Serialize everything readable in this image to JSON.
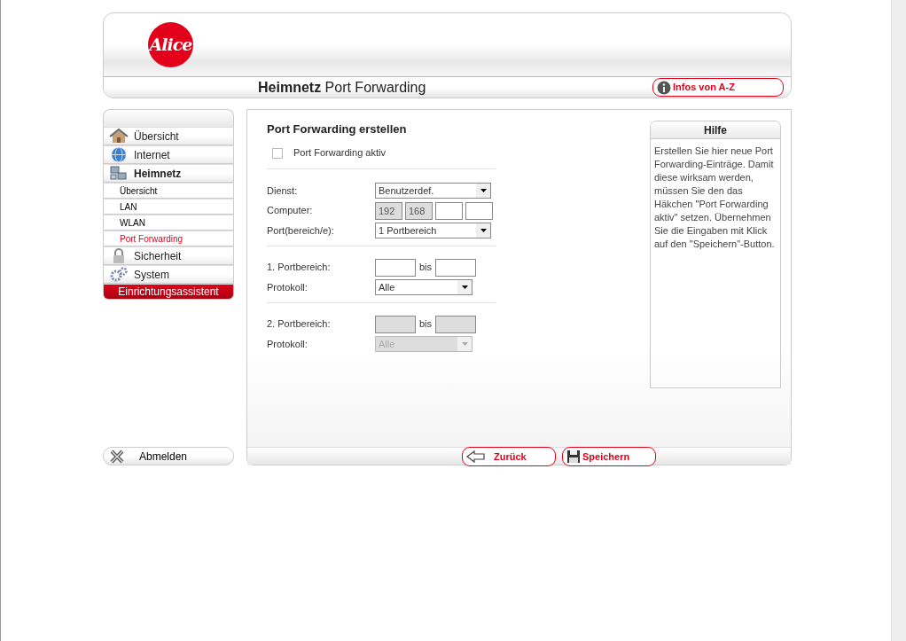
{
  "header": {
    "logo": "Alice",
    "title": "**Heimnetz** Port Forwarding",
    "info_button": "Infos von A-Z"
  },
  "sidebar": {
    "items": [
      {
        "kind": "main",
        "label": "Übersicht",
        "expanded": false
      },
      {
        "kind": "main",
        "label": "Internet",
        "expanded": false
      },
      {
        "kind": "main",
        "label": "Heimnetz",
        "expanded": true
      },
      {
        "kind": "sub",
        "label": "Übersicht",
        "selected": false
      },
      {
        "kind": "sub",
        "label": "LAN",
        "selected": false
      },
      {
        "kind": "sub",
        "label": "WLAN",
        "selected": false
      },
      {
        "kind": "sub",
        "label": "Port Forwarding",
        "selected": true
      },
      {
        "kind": "main",
        "label": "Sicherheit",
        "expanded": false
      },
      {
        "kind": "main",
        "label": "System",
        "expanded": false
      },
      {
        "kind": "wizard",
        "label": "Einrichtungsassistent"
      }
    ],
    "logout": "Abmelden"
  },
  "form": {
    "title": "Port Forwarding erstellen",
    "active_checkbox": {
      "label": "Port Forwarding aktiv",
      "checked": false
    },
    "sections": [
      {
        "disabled": false,
        "rows": [
          {
            "kind": "select",
            "label": "Dienst:",
            "value": "Benutzerdef."
          },
          {
            "kind": "ip",
            "label": "Computer:",
            "parts": [
              {
                "value": "192",
                "disabled": true
              },
              {
                "value": "168",
                "disabled": true
              },
              {
                "disabled": false
              },
              {
                "disabled": false
              }
            ]
          },
          {
            "kind": "select",
            "label": "Port(bereich/e):",
            "value": "1 Portbereich"
          }
        ]
      },
      {
        "disabled": false,
        "rows": [
          {
            "kind": "range",
            "label": "1. Portbereich:",
            "separator": "bis"
          },
          {
            "kind": "select",
            "label": "Protokoll:",
            "value": "Alle"
          }
        ]
      },
      {
        "disabled": true,
        "rows": [
          {
            "kind": "range",
            "label": "2. Portbereich:",
            "separator": "bis"
          },
          {
            "kind": "select",
            "label": "Protokoll:",
            "value": "Alle"
          }
        ]
      }
    ]
  },
  "help": {
    "title": "Hilfe",
    "text": "Erstellen Sie hier neue Port Forwarding-Einträge. Damit diese wirksam werden, müssen Sie den das Häkchen \"Port Forwarding aktiv\" setzen. Übernehmen Sie die Eingaben mit Klick auf den \"Speichern\"-Button."
  },
  "buttons": [
    {
      "kind": "back",
      "label": "Zurück"
    },
    {
      "kind": "save",
      "label": "Speichern"
    }
  ]
}
